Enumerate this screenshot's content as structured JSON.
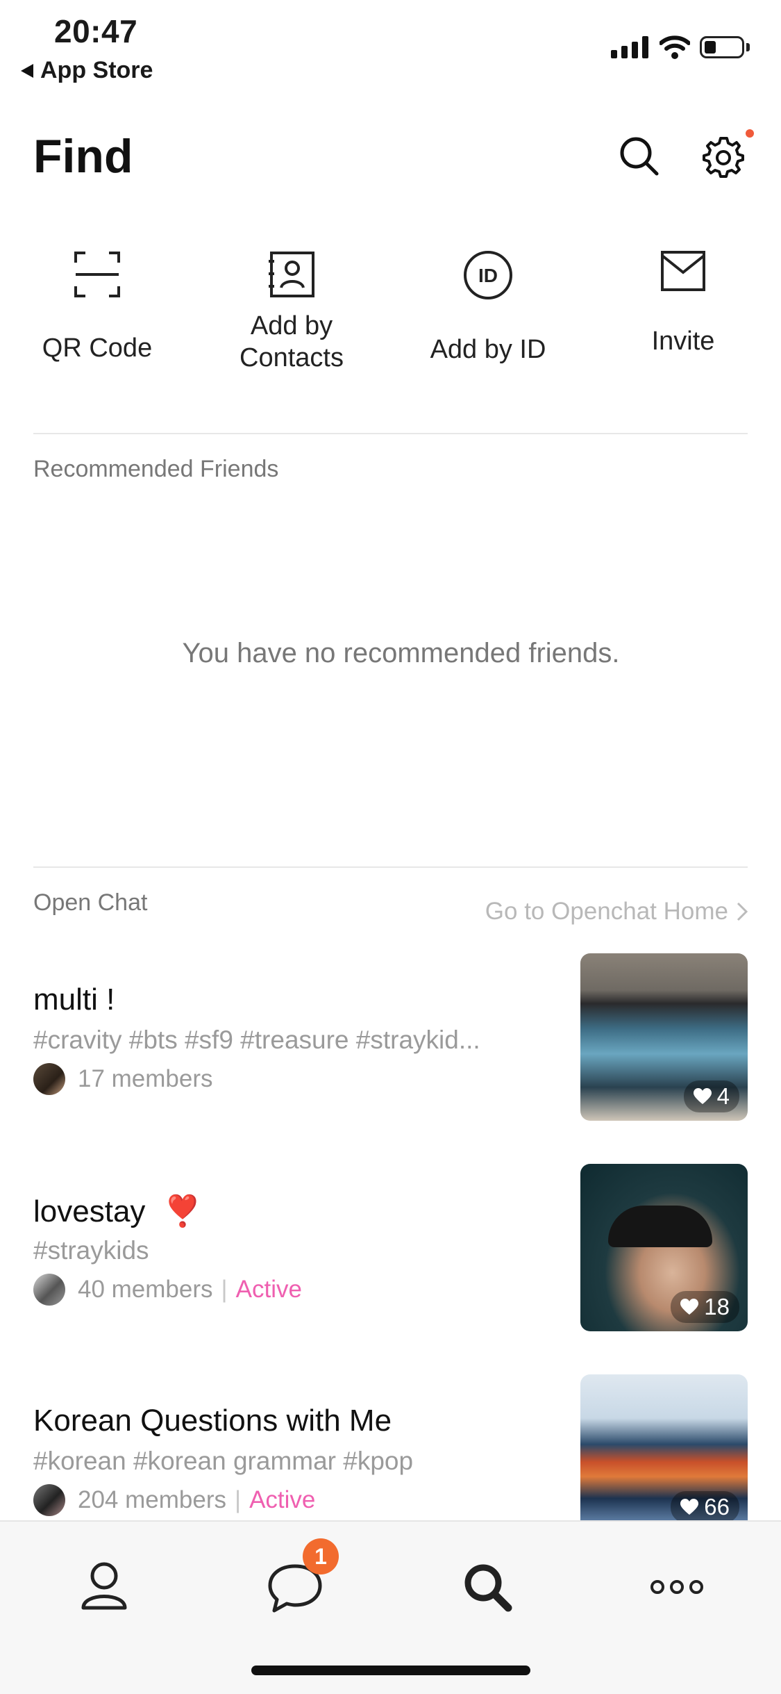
{
  "status_bar": {
    "time": "20:47",
    "back_label": "App Store"
  },
  "header": {
    "title": "Find",
    "search_icon": "search-icon",
    "settings_icon": "gear-icon"
  },
  "actions": [
    {
      "label": "QR Code",
      "icon": "qr-scan-icon"
    },
    {
      "label": "Add by Contacts",
      "icon": "contacts-book-icon"
    },
    {
      "label": "Add by ID",
      "icon": "id-circle-icon"
    },
    {
      "label": "Invite",
      "icon": "envelope-icon"
    }
  ],
  "recommended": {
    "title": "Recommended Friends",
    "empty_message": "You have no recommended friends."
  },
  "open_chat": {
    "title": "Open Chat",
    "home_link": "Go to Openchat Home",
    "items": [
      {
        "name": "multi !",
        "tags": "#cravity #bts #sf9 #treasure #straykid...",
        "members": "17 members",
        "status": "",
        "likes": "4"
      },
      {
        "name": "lovestay",
        "emoji": "❣️",
        "tags": "#straykids",
        "members": "40 members",
        "status": "Active",
        "likes": "18"
      },
      {
        "name": "Korean Questions with Me",
        "tags": "#korean #korean grammar #kpop",
        "members": "204 members",
        "status": "Active",
        "likes": "66"
      }
    ]
  },
  "tabbar": {
    "items": [
      "person-icon",
      "chat-bubble-icon",
      "search-icon",
      "more-icon"
    ],
    "chat_badge": "1"
  },
  "colors": {
    "accent_active": "#ef5fb0",
    "badge": "#f26b2e",
    "notify_dot": "#f05a3a"
  }
}
